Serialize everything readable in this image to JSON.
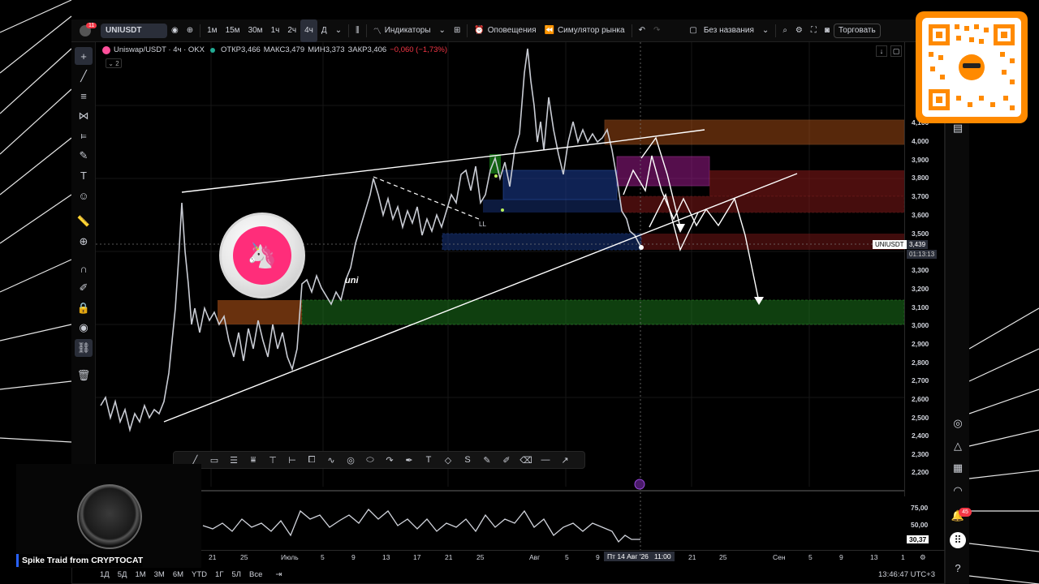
{
  "topbar": {
    "notification_count": "11",
    "symbol": "UNIUSDT",
    "timeframes": [
      "1м",
      "15м",
      "30м",
      "1ч",
      "2ч",
      "4ч",
      "Д"
    ],
    "active_timeframe": "4ч",
    "indicators_label": "Индикаторы",
    "alerts_label": "Оповещения",
    "replay_label": "Симулятор рынка",
    "layout_name": "Без названия",
    "trade_label": "Торговать"
  },
  "legend": {
    "pair": "Uniswap/USDT · 4ч · OKX",
    "open": "ОТКР3,466",
    "high": "МАКС3,479",
    "low": "МИН3,373",
    "close": "ЗАКР3,406",
    "change": "−0,060 (−1,73%)",
    "indicator_count": "2"
  },
  "chart": {
    "annotation_ll": "LL",
    "annotation_uni": "uni",
    "symbol_tag": "UNIUSDT",
    "current_price": "3,439",
    "countdown": "01:13:13",
    "price_labels": [
      "4,100",
      "4,000",
      "3,900",
      "3,800",
      "3,700",
      "3,600",
      "3,500",
      "3,300",
      "3,200",
      "3,100",
      "3,000",
      "2,900",
      "2,800",
      "2,700",
      "2,600",
      "2,500",
      "2,400",
      "2,300",
      "2,200"
    ]
  },
  "oscillator": {
    "levels": [
      "75,00",
      "50,00"
    ],
    "current": "30,37"
  },
  "time_axis": {
    "labels": [
      "21",
      "25",
      "Июль",
      "5",
      "9",
      "13",
      "17",
      "21",
      "25",
      "Авг",
      "5",
      "9",
      "21",
      "25",
      "Сен",
      "5",
      "9",
      "13",
      "1"
    ],
    "cursor_date": "Пт 14 Авг '26",
    "cursor_time": "11:00"
  },
  "bottombar": {
    "ranges": [
      "1Д",
      "5Д",
      "1М",
      "3М",
      "6М",
      "YTD",
      "1Г",
      "5Л",
      "Все"
    ],
    "clock": "13:46:47 UTC+3"
  },
  "right_sidebar": {
    "notifications_badge": "45"
  },
  "stream": {
    "streamer": "Spike Traid from CRYPTOCAT"
  },
  "colors": {
    "background": "#000000",
    "candle": "#d1d4dc",
    "zone_orange": "#c05a1a",
    "zone_red": "#8b1a1a",
    "zone_blue": "#1a3a8a",
    "zone_green": "#1a6a1a",
    "zone_magenta": "#9b1a8b",
    "accent_qr": "#ff8a00"
  }
}
